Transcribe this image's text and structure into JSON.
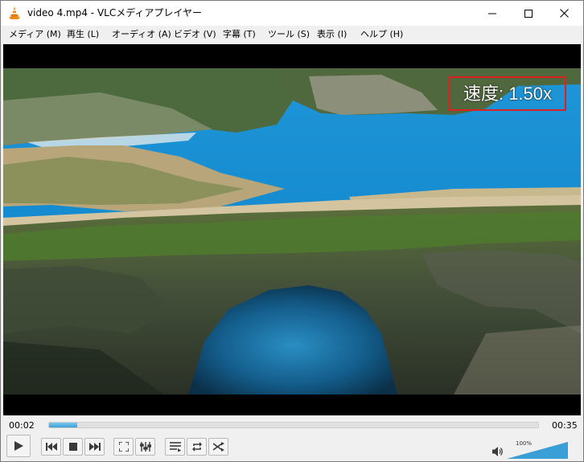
{
  "window": {
    "title": "video 4.mp4 - VLCメディアプレイヤー",
    "icon": "vlc-cone-icon",
    "controls": [
      "minimize-icon",
      "maximize-icon",
      "close-icon"
    ]
  },
  "menu": {
    "items": [
      {
        "label": "メディア (M)"
      },
      {
        "label": "再生 (L)"
      },
      {
        "label": "オーディオ (A)"
      },
      {
        "label": "ビデオ (V)"
      },
      {
        "label": "字幕 (T)"
      },
      {
        "label": "ツール (S)"
      },
      {
        "label": "表示 (I)"
      },
      {
        "label": "ヘルプ (H)"
      }
    ]
  },
  "video": {
    "osd_speed": "速度: 1.50x"
  },
  "playback": {
    "elapsed": "00:02",
    "total": "00:35",
    "progress": 0.057
  },
  "controls": {
    "buttons": [
      "play-icon",
      "previous-icon",
      "stop-icon",
      "next-icon",
      "fullscreen-icon",
      "extended-settings-icon",
      "playlist-icon",
      "loop-icon",
      "shuffle-icon"
    ]
  },
  "volume": {
    "label": "100%",
    "level": 1.0,
    "icon": "speaker-icon"
  },
  "colors": {
    "accent": "#3a9fd6",
    "osd_border": "#e02020",
    "cone_orange": "#f08a1c"
  }
}
